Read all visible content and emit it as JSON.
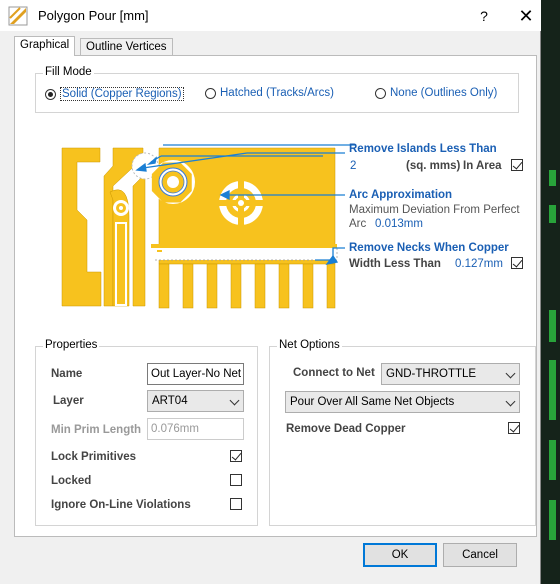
{
  "window": {
    "title": "Polygon Pour [mm]",
    "help": "?",
    "close": "✕"
  },
  "tabs": [
    {
      "label": "Graphical"
    },
    {
      "label": "Outline Vertices"
    }
  ],
  "fill_mode": {
    "title": "Fill Mode",
    "options": [
      {
        "label": "Solid (Copper Regions)",
        "checked": true
      },
      {
        "label": "Hatched (Tracks/Arcs)",
        "checked": false
      },
      {
        "label": "None (Outlines Only)",
        "checked": false
      }
    ]
  },
  "diagram": {
    "islands": {
      "title": "Remove Islands Less Than",
      "value": "2",
      "unit": "(sq. mms)",
      "in_area": "In Area",
      "checked": true
    },
    "arc": {
      "title": "Arc Approximation",
      "desc1": "Maximum Deviation From Perfect",
      "desc2": "Arc",
      "value": "0.013mm"
    },
    "necks": {
      "title": "Remove Necks When Copper",
      "label": "Width Less Than",
      "value": "0.127mm",
      "checked": true
    },
    "colors": {
      "copper": "#f7c21e",
      "arrow": "#1a7fd4"
    }
  },
  "properties": {
    "title": "Properties",
    "name_label": "Name",
    "name_value": "Out Layer-No Net",
    "layer_label": "Layer",
    "layer_value": "ART04",
    "minprim_label": "Min Prim Length",
    "minprim_value": "0.076mm",
    "lock_label": "Lock Primitives",
    "lock_checked": true,
    "locked_label": "Locked",
    "locked_checked": false,
    "ignore_label": "Ignore On-Line Violations",
    "ignore_checked": false
  },
  "net_options": {
    "title": "Net Options",
    "connect_label": "Connect to Net",
    "connect_value": "GND-THROTTLE",
    "pour_value": "Pour Over All Same Net Objects",
    "dead_label": "Remove Dead Copper",
    "dead_checked": true
  },
  "buttons": {
    "ok": "OK",
    "cancel": "Cancel"
  }
}
